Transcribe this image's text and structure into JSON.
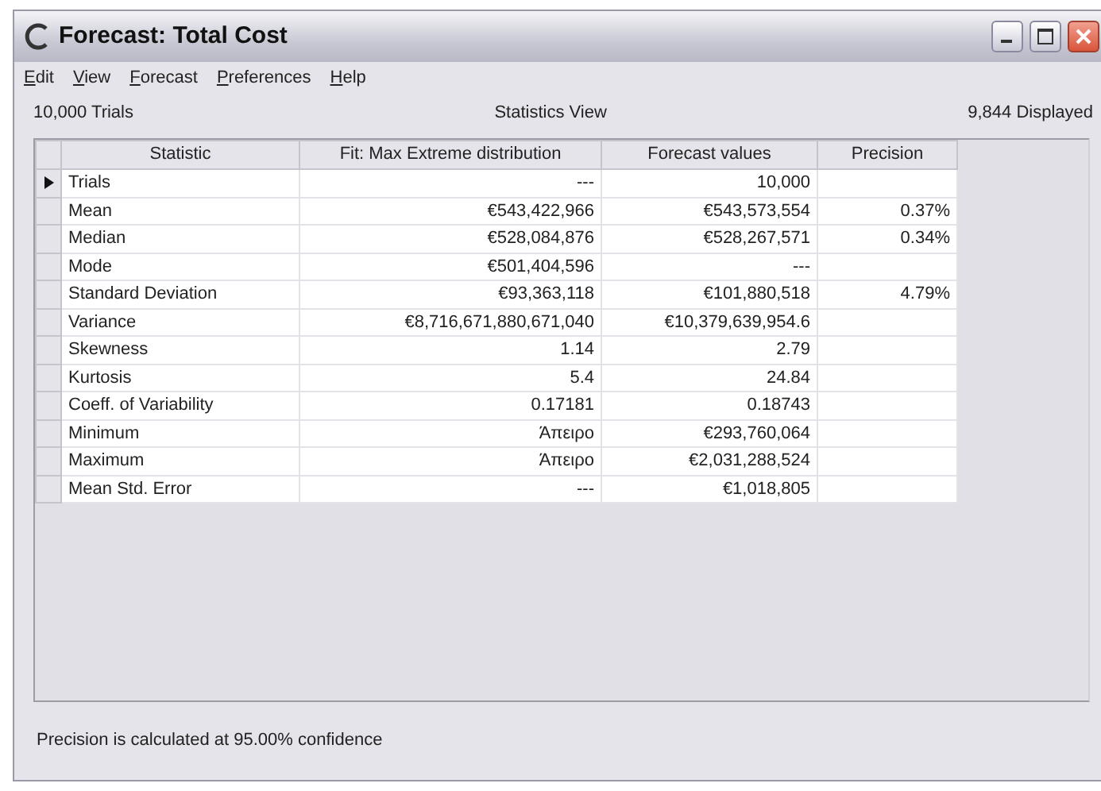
{
  "window": {
    "title": "Forecast: Total Cost"
  },
  "menu": [
    {
      "label": "Edit"
    },
    {
      "label": "View"
    },
    {
      "label": "Forecast"
    },
    {
      "label": "Preferences"
    },
    {
      "label": "Help"
    }
  ],
  "info_bar": {
    "trials": "10,000 Trials",
    "view": "Statistics View",
    "displayed": "9,844 Displayed"
  },
  "table": {
    "columns": [
      "Statistic",
      "Fit: Max Extreme distribution",
      "Forecast values",
      "Precision"
    ],
    "rows": [
      {
        "selected": true,
        "cells": [
          "Trials",
          "---",
          "10,000",
          ""
        ]
      },
      {
        "selected": false,
        "cells": [
          "Mean",
          "€543,422,966",
          "€543,573,554",
          "0.37%"
        ]
      },
      {
        "selected": false,
        "cells": [
          "Median",
          "€528,084,876",
          "€528,267,571",
          "0.34%"
        ]
      },
      {
        "selected": false,
        "cells": [
          "Mode",
          "€501,404,596",
          "---",
          ""
        ]
      },
      {
        "selected": false,
        "cells": [
          "Standard Deviation",
          "€93,363,118",
          "€101,880,518",
          "4.79%"
        ]
      },
      {
        "selected": false,
        "cells": [
          "Variance",
          "€8,716,671,880,671,040",
          "€10,379,639,954.6",
          ""
        ]
      },
      {
        "selected": false,
        "cells": [
          "Skewness",
          "1.14",
          "2.79",
          ""
        ]
      },
      {
        "selected": false,
        "cells": [
          "Kurtosis",
          "5.4",
          "24.84",
          ""
        ]
      },
      {
        "selected": false,
        "cells": [
          "Coeff. of Variability",
          "0.17181",
          "0.18743",
          ""
        ]
      },
      {
        "selected": false,
        "cells": [
          "Minimum",
          "Άπειρο",
          "€293,760,064",
          ""
        ]
      },
      {
        "selected": false,
        "cells": [
          "Maximum",
          "Άπειρο",
          "€2,031,288,524",
          ""
        ]
      },
      {
        "selected": false,
        "cells": [
          "Mean Std. Error",
          "---",
          "€1,018,805",
          ""
        ]
      }
    ]
  },
  "status_bar": "Precision is calculated at 95.00% confidence"
}
